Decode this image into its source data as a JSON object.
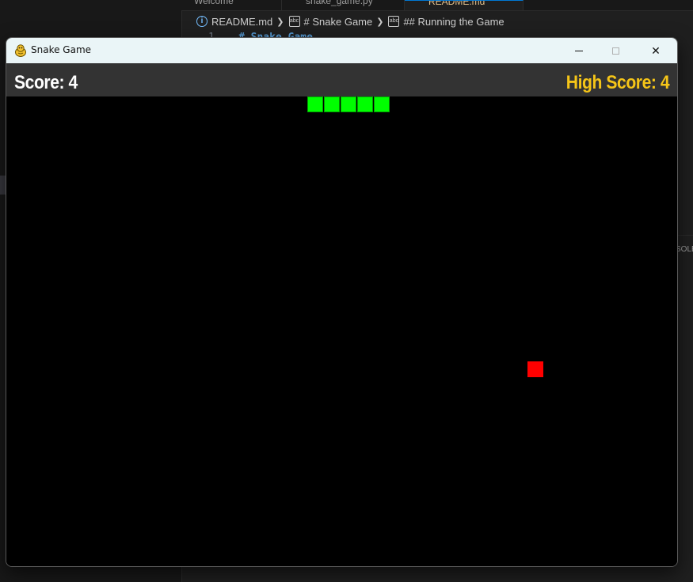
{
  "editor": {
    "tabs": [
      {
        "label": "Welcome"
      },
      {
        "label": "snake_game.py"
      },
      {
        "label": "README.md"
      }
    ],
    "breadcrumb": {
      "file": "README.md",
      "section1": "# Snake Game",
      "section2": "## Running the Game"
    },
    "code_line_number": "1",
    "code_line_text": "# Snake Game",
    "panel_tab_partial": "SOLE"
  },
  "window": {
    "title": "Snake Game",
    "icon": "python-snake-icon",
    "controls": {
      "minimize": "minimize-icon",
      "maximize": "maximize-icon",
      "close": "✕"
    }
  },
  "game": {
    "score_text": "Score: 4",
    "high_score_text": "High Score: 4",
    "score": 4,
    "high_score": 4,
    "colors": {
      "background": "#000000",
      "header": "#333333",
      "snake": "#00ff00",
      "food": "#ff0000",
      "score": "#ffffff",
      "high_score": "#f5c518"
    },
    "snake_cells": [
      [
        18,
        0
      ],
      [
        19,
        0
      ],
      [
        20,
        0
      ],
      [
        21,
        0
      ],
      [
        22,
        0
      ]
    ],
    "food_cell": [
      33,
      16
    ]
  }
}
